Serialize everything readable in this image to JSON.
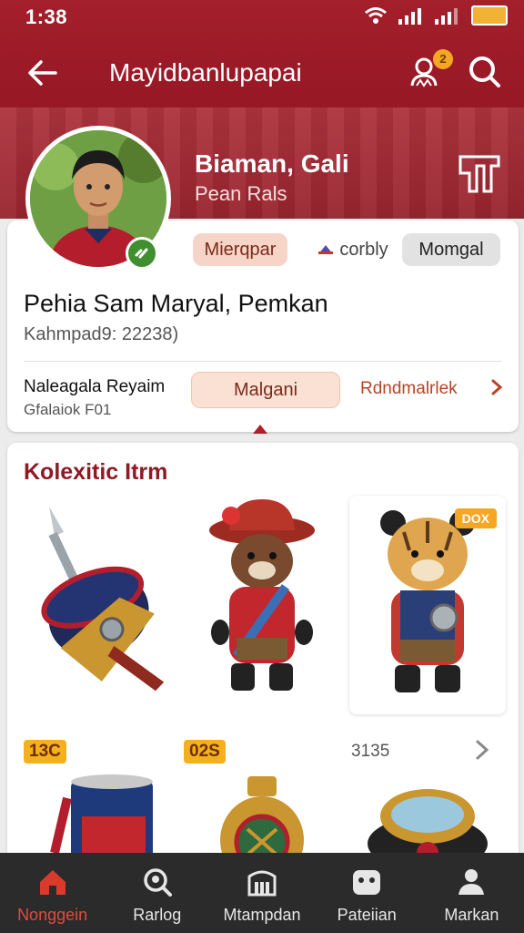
{
  "status_bar": {
    "time": "1:38"
  },
  "header": {
    "title": "Mayidbanlupapai",
    "notification_count": "2",
    "back_icon": "arrow-left-icon",
    "friends_icon": "friends-icon",
    "search_icon": "search-icon"
  },
  "profile": {
    "name": "Biaman, Gali",
    "subtitle": "Pean Rals",
    "chips": [
      "Mierqpar",
      "corbly",
      "Momgal"
    ],
    "full_name": "Pehia Sam Maryal, Pemkan",
    "meta": "Kahmpad9: 22238)",
    "club_title": "Naleagala Reyaim",
    "club_sub": "Gfalaiok F01",
    "action_label": "Malgani",
    "link_label": "Rdndmalrlek"
  },
  "collection": {
    "title": "Kolexitic Itrm",
    "items": [
      {
        "name": "spear-shield-item",
        "tag": ""
      },
      {
        "name": "red-hat-bear-item",
        "tag": ""
      },
      {
        "name": "tiger-warrior-item",
        "tag": "DOX"
      }
    ],
    "prices": [
      "13C",
      "02S",
      "3135"
    ],
    "lower_items": [
      "can-item",
      "jar-item",
      "ring-item"
    ]
  },
  "bottom_nav": [
    {
      "label": "Nonggein",
      "icon": "home-icon",
      "active": true
    },
    {
      "label": "Rarlog",
      "icon": "search-person-icon",
      "active": false
    },
    {
      "label": "Mtampdan",
      "icon": "stadium-icon",
      "active": false
    },
    {
      "label": "Pateiian",
      "icon": "game-icon",
      "active": false
    },
    {
      "label": "Markan",
      "icon": "profile-icon",
      "active": false
    }
  ],
  "colors": {
    "primary": "#9c1a27",
    "accent": "#f5a623",
    "nav_bg": "#2b2b2b",
    "active_nav": "#e24b3b"
  }
}
